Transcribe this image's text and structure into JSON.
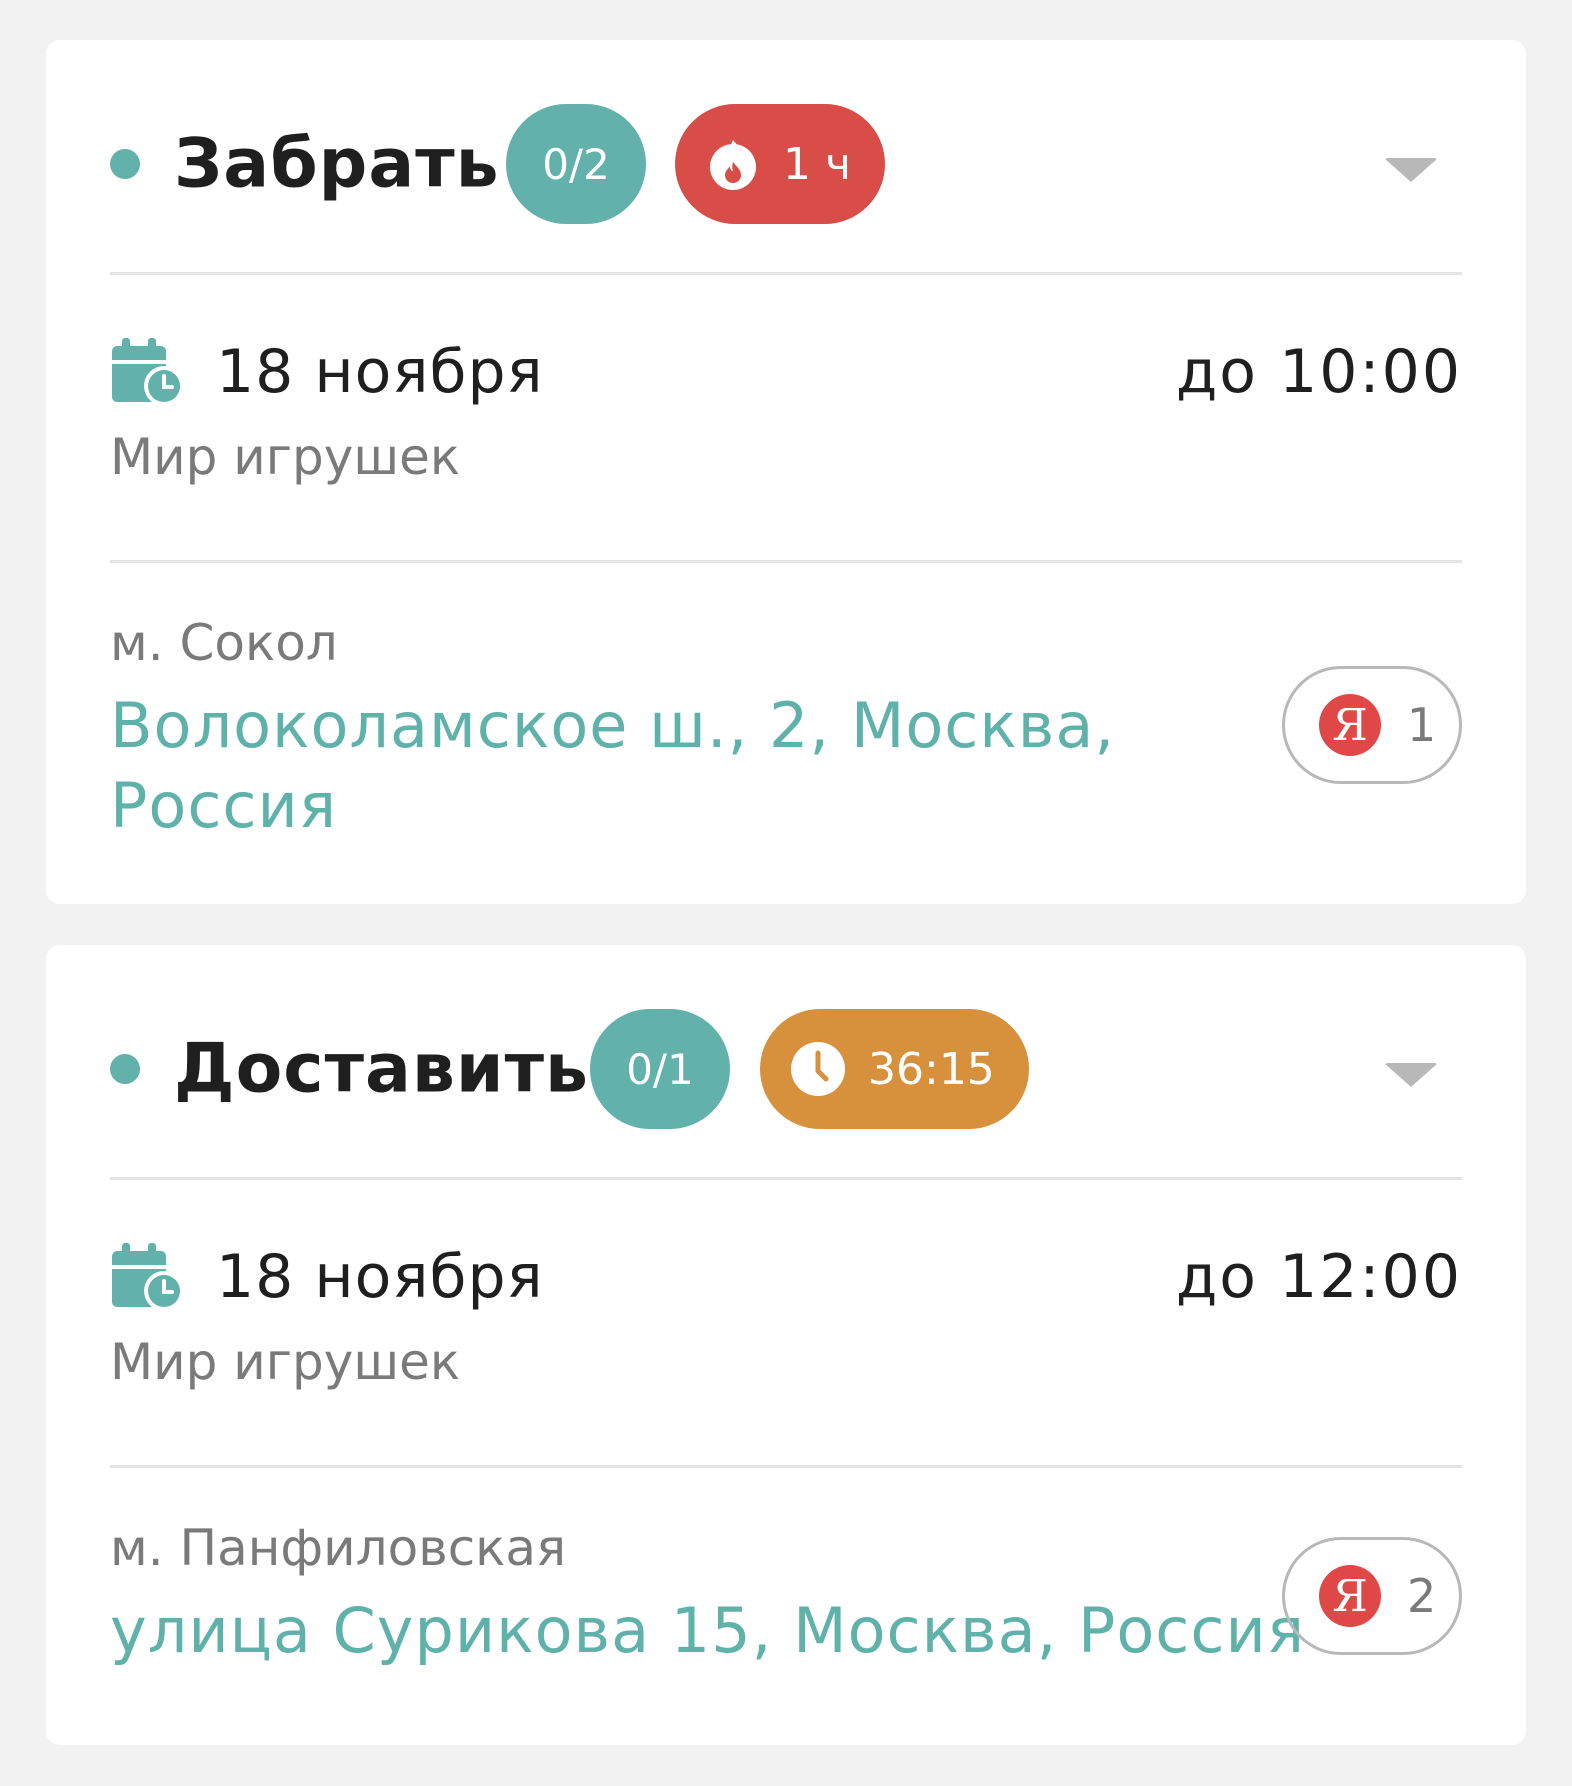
{
  "colors": {
    "teal": "#62b1aa",
    "urgent_red": "#d94d48",
    "warning_orange": "#d7903b",
    "link_teal": "#5fb2aa",
    "yandex_red": "#e04848"
  },
  "tasks": [
    {
      "title": "Забрать",
      "progress": "0/2",
      "timer_icon": "fire-icon",
      "timer_label": "1 ч",
      "date": "18 ноября",
      "deadline": "до 10:00",
      "merchant": "Мир игрушек",
      "metro": "м. Сокол",
      "address": "Волоколамское ш., 2, Москва, Россия",
      "nav_logo": "Я",
      "nav_count": "1"
    },
    {
      "title": "Доставить",
      "progress": "0/1",
      "timer_icon": "clock-icon",
      "timer_label": "36:15",
      "date": "18 ноября",
      "deadline": "до 12:00",
      "merchant": "Мир игрушек",
      "metro": "м. Панфиловская",
      "address": "улица Сурикова 15, Москва, Россия",
      "nav_logo": "Я",
      "nav_count": "2"
    }
  ]
}
